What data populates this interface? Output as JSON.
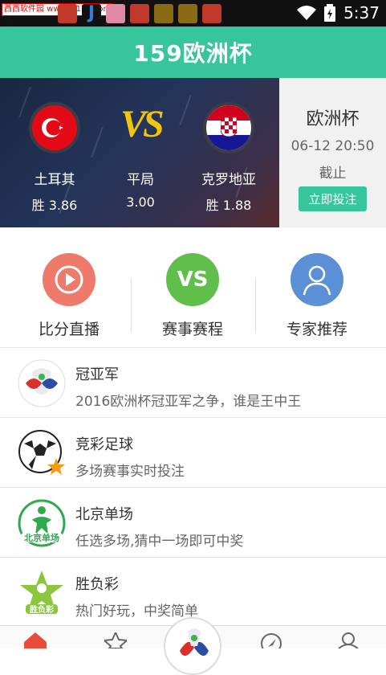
{
  "status_bar": {
    "watermark": "西西软件园 www.cr173.com",
    "app_icons": [
      "app-icon-red",
      "app-icon-j",
      "app-icon-pink",
      "app-icon-red",
      "app-icon-gold",
      "app-icon-gold",
      "app-icon-red"
    ],
    "time": "5:37"
  },
  "header": {
    "title": "159欧洲杯"
  },
  "match": {
    "home": {
      "name": "土耳其",
      "odds": "胜 3.86"
    },
    "vs_label": "VS",
    "draw": {
      "name": "平局",
      "odds": "3.00"
    },
    "away": {
      "name": "克罗地亚",
      "odds": "胜 1.88"
    },
    "panel": {
      "title": "欧洲杯",
      "datetime": "06-12 20:50",
      "deadline": "截止",
      "bet_label": "立即投注"
    }
  },
  "quick_actions": [
    {
      "label": "比分直播",
      "icon": "play-icon",
      "color": "#ee7a6b"
    },
    {
      "label": "赛事赛程",
      "icon": "vs-icon",
      "color": "#5fbf4a",
      "icon_text": "VS"
    },
    {
      "label": "专家推荐",
      "icon": "person-icon",
      "color": "#5b8fd6"
    }
  ],
  "lottery_list": [
    {
      "title": "冠亚军",
      "subtitle": "2016欧洲杯冠亚军之争，谁是王中王"
    },
    {
      "title": "竞彩足球",
      "subtitle": "多场赛事实时投注"
    },
    {
      "title": "北京单场",
      "subtitle": "任选多场,猜中一场即可中奖"
    },
    {
      "title": "胜负彩",
      "subtitle": "热门好玩，中奖简单"
    }
  ],
  "colors": {
    "accent": "#37c59c"
  }
}
